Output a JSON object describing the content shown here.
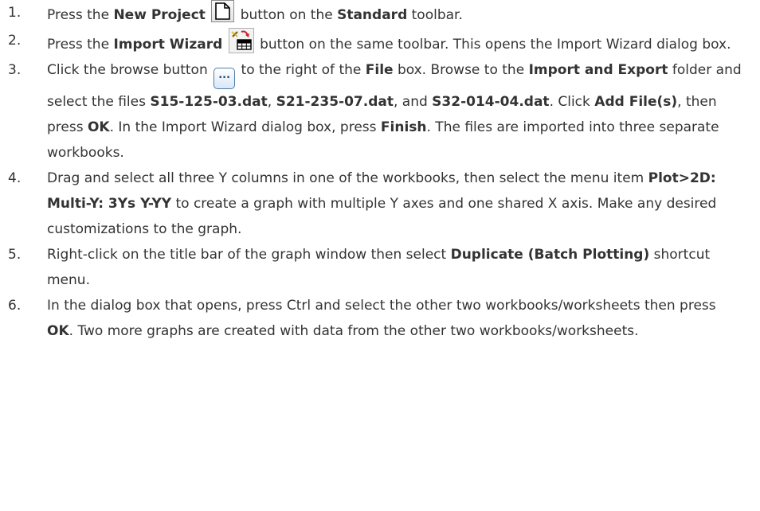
{
  "steps": [
    {
      "num": "1.",
      "segments": [
        {
          "t": "Press the "
        },
        {
          "t": "New Project",
          "b": true
        },
        {
          "t": " "
        },
        {
          "icon": "new-project-icon"
        },
        {
          "t": " button on the "
        },
        {
          "t": "Standard",
          "b": true
        },
        {
          "t": " toolbar."
        }
      ]
    },
    {
      "num": "2.",
      "segments": [
        {
          "t": "Press the "
        },
        {
          "t": "Import Wizard",
          "b": true
        },
        {
          "t": " "
        },
        {
          "icon": "import-wizard-icon"
        },
        {
          "t": " button on the same toolbar. This opens the Import Wizard dialog box."
        }
      ]
    },
    {
      "num": "3.",
      "segments": [
        {
          "t": "Click the browse button "
        },
        {
          "icon": "browse-icon"
        },
        {
          "t": " to the right of the "
        },
        {
          "t": "File",
          "b": true
        },
        {
          "t": " box. Browse to the "
        },
        {
          "t": "Import and Export",
          "b": true
        },
        {
          "t": " folder and select the files "
        },
        {
          "t": "S15-125-03.dat",
          "b": true
        },
        {
          "t": ", "
        },
        {
          "t": "S21-235-07.dat",
          "b": true
        },
        {
          "t": ", and "
        },
        {
          "t": "S32-014-04.dat",
          "b": true
        },
        {
          "t": ". Click "
        },
        {
          "t": "Add File(s)",
          "b": true
        },
        {
          "t": ", then press "
        },
        {
          "t": "OK",
          "b": true
        },
        {
          "t": ". In the Import Wizard dialog box, press "
        },
        {
          "t": "Finish",
          "b": true
        },
        {
          "t": ". The files are imported into three separate workbooks."
        }
      ]
    },
    {
      "num": "4.",
      "segments": [
        {
          "t": "Drag and select all three Y columns in one of the workbooks, then select the menu item "
        },
        {
          "t": "Plot>2D: Multi-Y: 3Ys Y-YY",
          "b": true
        },
        {
          "t": " to create a graph with multiple Y axes and one shared X axis. Make any desired customizations to the graph."
        }
      ]
    },
    {
      "num": "5.",
      "segments": [
        {
          "t": "Right-click on the title bar of the graph window then select "
        },
        {
          "t": "Duplicate (Batch Plotting)",
          "b": true
        },
        {
          "t": " shortcut menu."
        }
      ]
    },
    {
      "num": "6.",
      "segments": [
        {
          "t": "In the dialog box that opens, press Ctrl and select the other two workbooks/worksheets then press "
        },
        {
          "t": "OK",
          "b": true
        },
        {
          "t": ". Two more graphs are created with data from the other two workbooks/worksheets."
        }
      ]
    }
  ],
  "icons": {
    "browse_glyph": "..."
  }
}
